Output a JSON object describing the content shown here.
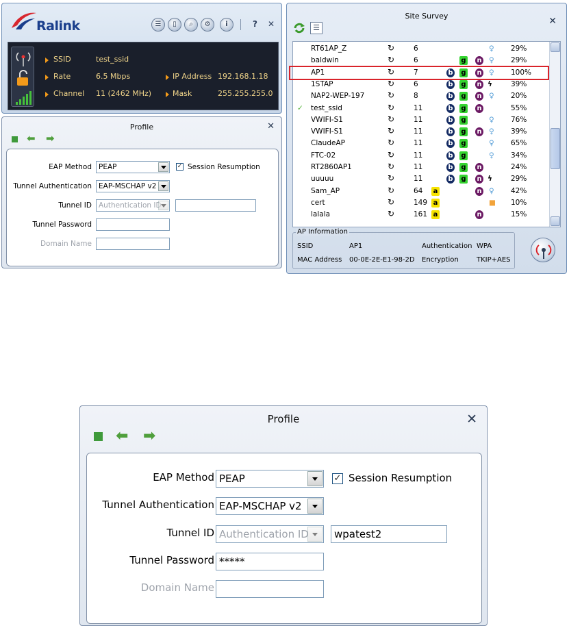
{
  "ralink": {
    "logo": "Ralink",
    "header_buttons": [
      "list-icon",
      "page-icon",
      "search-icon",
      "gear-icon",
      "info-icon"
    ],
    "help_label": "?",
    "close_label": "✕",
    "status": {
      "ssid_label": "SSID",
      "ssid_value": "test_ssid",
      "rate_label": "Rate",
      "rate_value": "6.5 Mbps",
      "channel_label": "Channel",
      "channel_value": "11 (2462 MHz)",
      "ip_label": "IP Address",
      "ip_value": "192.168.1.18",
      "mask_label": "Mask",
      "mask_value": "255.255.255.0"
    }
  },
  "profile_small": {
    "title": "Profile",
    "close": "✕",
    "eap_method_label": "EAP Method",
    "eap_method_value": "PEAP",
    "session_resumption_label": "Session Resumption",
    "session_resumption_checked": "✓",
    "tunnel_auth_label": "Tunnel Authentication",
    "tunnel_auth_value": "EAP-MSCHAP v2",
    "tunnel_id_label": "Tunnel ID",
    "tunnel_id_select": "Authentication ID",
    "tunnel_id_value": "",
    "tunnel_password_label": "Tunnel Password",
    "tunnel_password_value": "",
    "domain_name_label": "Domain Name",
    "domain_name_value": ""
  },
  "profile_large": {
    "title": "Profile",
    "close": "✕",
    "eap_method_label": "EAP Method",
    "eap_method_value": "PEAP",
    "session_resumption_label": "Session Resumption",
    "session_resumption_checked": "✓",
    "tunnel_auth_label": "Tunnel Authentication",
    "tunnel_auth_value": "EAP-MSCHAP v2",
    "tunnel_id_label": "Tunnel ID",
    "tunnel_id_select": "Authentication ID",
    "tunnel_id_value": "wpatest2",
    "tunnel_password_label": "Tunnel Password",
    "tunnel_password_value": "*****",
    "domain_name_label": "Domain Name",
    "domain_name_value": ""
  },
  "survey": {
    "title": "Site Survey",
    "close": "✕",
    "rows": [
      {
        "ssid": "RT61AP_Z",
        "ch": "6",
        "b": "",
        "g": "",
        "n": "",
        "wps": "",
        "sec": "key",
        "signal": "29%"
      },
      {
        "ssid": "baldwin",
        "ch": "6",
        "b": "",
        "g": "g",
        "n": "n",
        "wps": "",
        "sec": "key",
        "signal": "29%"
      },
      {
        "ssid": "AP1",
        "ch": "7",
        "b": "b",
        "g": "g",
        "n": "n",
        "wps": "",
        "sec": "key",
        "signal": "100%",
        "selected": true
      },
      {
        "ssid": "1STAP",
        "ch": "6",
        "b": "b",
        "g": "g",
        "n": "n",
        "wps": "wps",
        "sec": "",
        "signal": "39%"
      },
      {
        "ssid": "NAP2-WEP-197",
        "ch": "8",
        "b": "b",
        "g": "g",
        "n": "n",
        "wps": "",
        "sec": "key",
        "signal": "20%"
      },
      {
        "ssid": "test_ssid",
        "ch": "11",
        "b": "b",
        "g": "g",
        "n": "n",
        "wps": "",
        "sec": "",
        "signal": "55%",
        "connected": "✓"
      },
      {
        "ssid": "VWIFI-S1",
        "ch": "11",
        "b": "b",
        "g": "g",
        "n": "",
        "wps": "",
        "sec": "key",
        "signal": "76%"
      },
      {
        "ssid": "VWIFI-S1",
        "ch": "11",
        "b": "b",
        "g": "g",
        "n": "n",
        "wps": "",
        "sec": "key",
        "signal": "39%"
      },
      {
        "ssid": "ClaudeAP",
        "ch": "11",
        "b": "b",
        "g": "g",
        "n": "",
        "wps": "",
        "sec": "key",
        "signal": "65%"
      },
      {
        "ssid": "FTC-02",
        "ch": "11",
        "b": "b",
        "g": "g",
        "n": "",
        "wps": "",
        "sec": "key",
        "signal": "34%"
      },
      {
        "ssid": "RT2860AP1",
        "ch": "11",
        "b": "b",
        "g": "g",
        "n": "n",
        "wps": "",
        "sec": "",
        "signal": "24%"
      },
      {
        "ssid": "uuuuu",
        "ch": "11",
        "b": "b",
        "g": "g",
        "n": "n",
        "wps": "wps",
        "sec": "",
        "signal": "29%"
      },
      {
        "ssid": "Sam_AP",
        "ch": "64",
        "a": "a",
        "b": "",
        "g": "",
        "n": "n",
        "wps": "",
        "sec": "key",
        "signal": "42%"
      },
      {
        "ssid": "cert",
        "ch": "149",
        "a": "a",
        "b": "",
        "g": "",
        "n": "",
        "wps": "",
        "sec": "lock",
        "signal": "10%"
      },
      {
        "ssid": "lalala",
        "ch": "161",
        "a": "a",
        "b": "",
        "g": "",
        "n": "n",
        "wps": "",
        "sec": "",
        "signal": "15%"
      }
    ],
    "ap_info": {
      "legend": "AP Information",
      "ssid_label": "SSID",
      "ssid_value": "AP1",
      "auth_label": "Authentication",
      "auth_value": "WPA",
      "mac_label": "MAC Address",
      "mac_value": "00-0E-2E-E1-98-2D",
      "enc_label": "Encryption",
      "enc_value": "TKIP+AES"
    }
  },
  "colors": {
    "accent": "#1a3e8c",
    "selection_border": "#d9232a",
    "status_bg": "#1a1f2b",
    "status_text": "#f1d58a"
  }
}
